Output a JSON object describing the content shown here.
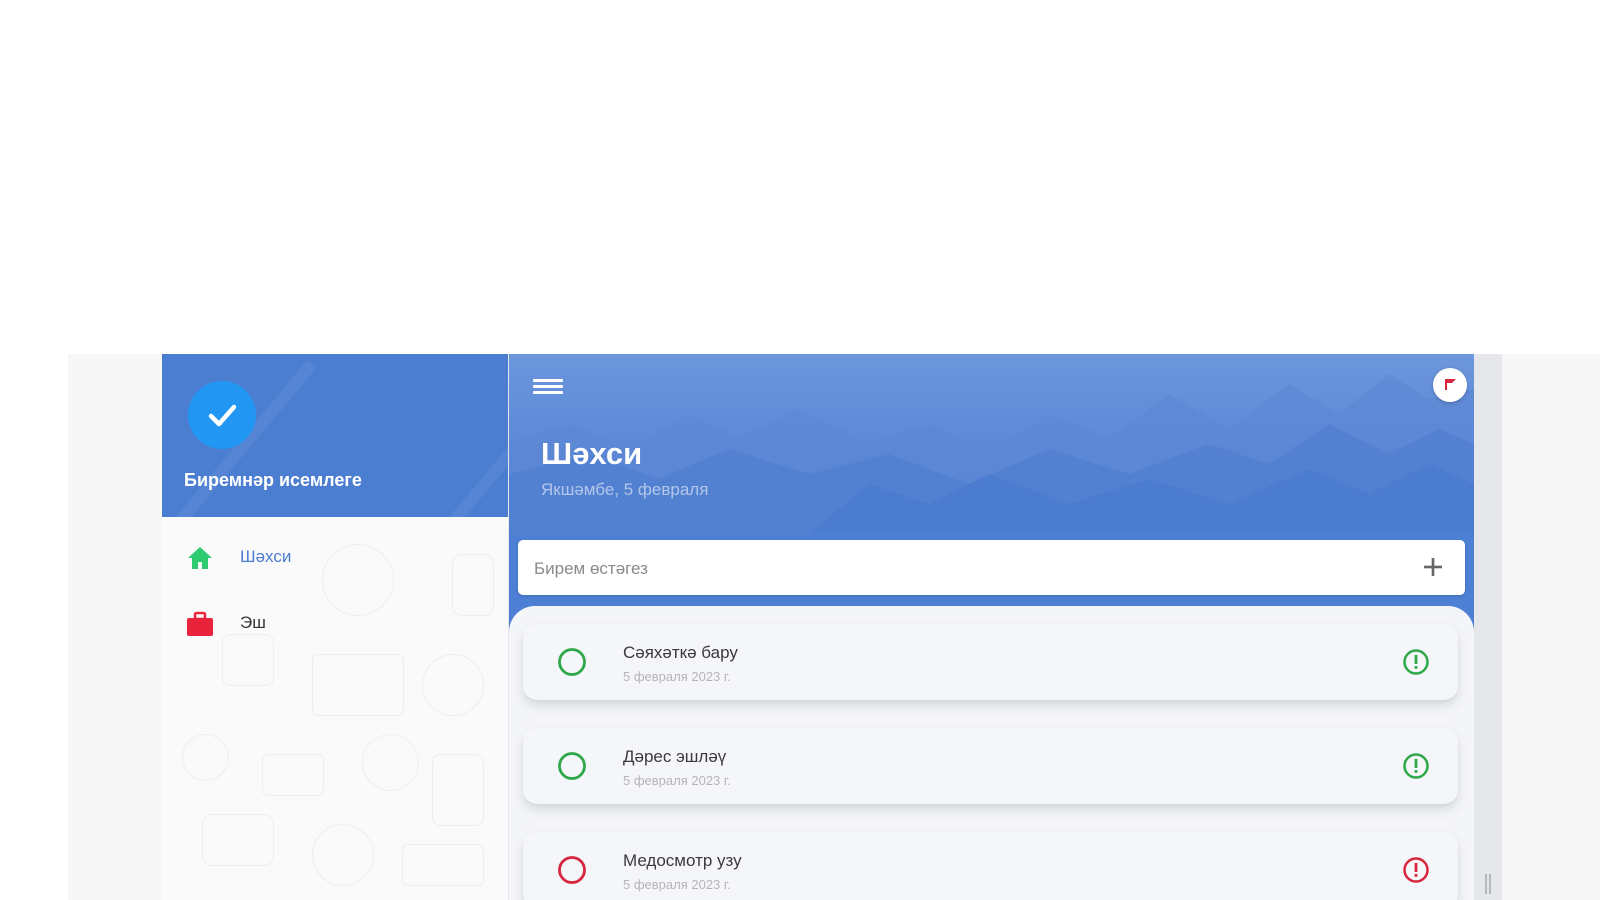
{
  "sidebar": {
    "app_name": "Биремнәр исемлеге",
    "items": [
      {
        "label": "Шәхси",
        "icon": "home-icon",
        "color": "#2ecc71"
      },
      {
        "label": "Эш",
        "icon": "briefcase-icon",
        "color": "#e8233b"
      }
    ]
  },
  "header": {
    "title": "Шәхси",
    "date": "Якшәмбе, 5 февраля"
  },
  "add_task": {
    "placeholder": "Бирем өстәгез"
  },
  "tasks": [
    {
      "title": "Сәяхәткә бару",
      "date": "5 февраля 2023 г.",
      "color": "#2ea84a"
    },
    {
      "title": "Дәрес эшләү",
      "date": "5 февраля 2023 г.",
      "color": "#2ea84a"
    },
    {
      "title": "Медосмотр узу",
      "date": "5 февраля 2023 г.",
      "color": "#d7263d"
    }
  ],
  "colors": {
    "header_blue": "#4d7fd4",
    "logo_blue": "#2196f3",
    "active_nav_text": "#4b7ed1"
  }
}
